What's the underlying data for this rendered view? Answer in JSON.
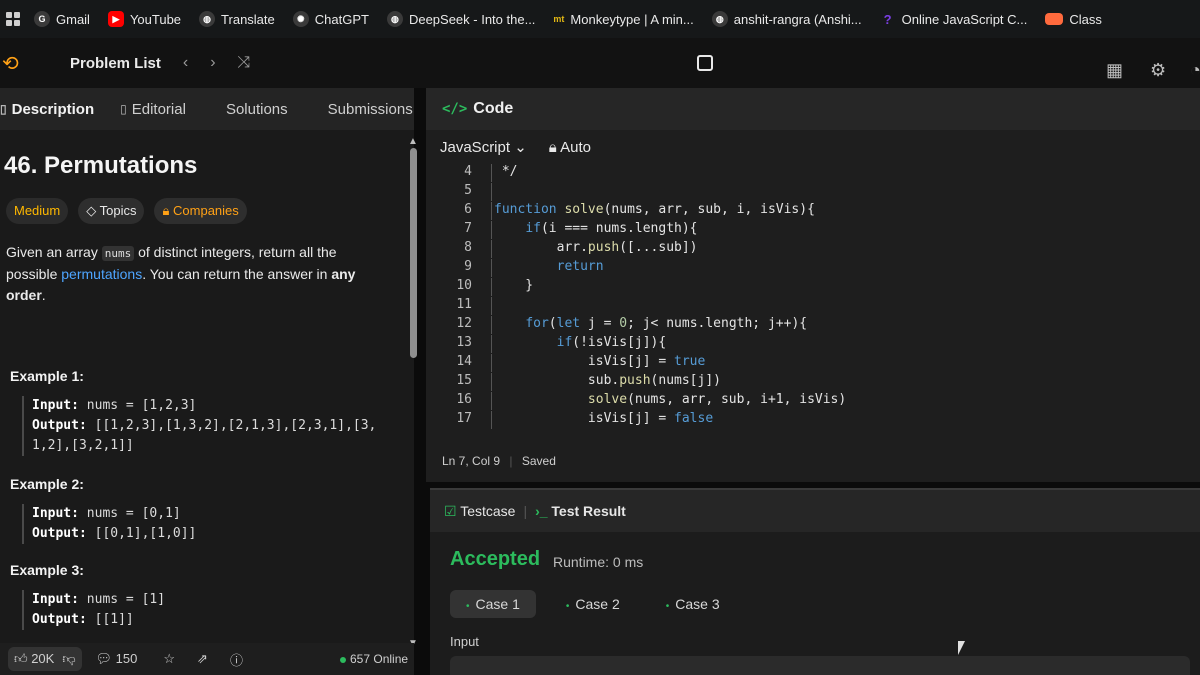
{
  "bookmarks": [
    {
      "label": "Gmail",
      "icon": "gmail-icon",
      "color": "#3a3a3a"
    },
    {
      "label": "YouTube",
      "icon": "youtube-icon",
      "color": "#ff0000"
    },
    {
      "label": "Translate",
      "icon": "translate-icon",
      "color": "#3a3a3a"
    },
    {
      "label": "ChatGPT",
      "icon": "chatgpt-icon",
      "color": "#3a3a3a"
    },
    {
      "label": "DeepSeek - Into the...",
      "icon": "deepseek-icon",
      "color": "#3a3a3a"
    },
    {
      "label": "Monkeytype | A min...",
      "icon": "monkeytype-icon",
      "color": "#e2b714"
    },
    {
      "label": "anshit-rangra (Anshi...",
      "icon": "github-icon",
      "color": "#3a3a3a"
    },
    {
      "label": "Online JavaScript C...",
      "icon": "js-compiler-icon",
      "color": "#7b3fe4"
    },
    {
      "label": "Class",
      "icon": "class-icon",
      "color": "#ff6a3d"
    }
  ],
  "nav": {
    "problem_list": "Problem List"
  },
  "tabs": {
    "description": "Description",
    "editorial": "Editorial",
    "solutions": "Solutions",
    "submissions": "Submissions"
  },
  "problem": {
    "title": "46. Permutations",
    "difficulty": "Medium",
    "topics": "Topics",
    "companies": "Companies",
    "desc_1": "Given an array",
    "desc_code": "nums",
    "desc_2": "of distinct integers, return all the possible",
    "desc_link": "permutations",
    "desc_3": ". You can return the answer in",
    "desc_bold": "any order",
    "desc_end": "."
  },
  "examples": [
    {
      "label": "Example 1:",
      "input_label": "Input:",
      "input": "nums = [1,2,3]",
      "output_label": "Output:",
      "output": "[[1,2,3],[1,3,2],[2,1,3],[2,3,1],[3,1,2],[3,2,1]]"
    },
    {
      "label": "Example 2:",
      "input_label": "Input:",
      "input": "nums = [0,1]",
      "output_label": "Output:",
      "output": "[[0,1],[1,0]]"
    },
    {
      "label": "Example 3:",
      "input_label": "Input:",
      "input": "nums = [1]",
      "output_label": "Output:",
      "output": "[[1]]"
    }
  ],
  "footer": {
    "likes": "20K",
    "comments": "150",
    "online": "657 Online"
  },
  "code": {
    "header": "Code",
    "language": "JavaScript",
    "mode": "Auto",
    "status_pos": "Ln 7, Col 9",
    "status_saved": "Saved",
    "lines": [
      {
        "n": "4",
        "text": " */"
      },
      {
        "n": "5",
        "text": ""
      },
      {
        "n": "6",
        "text": "function solve(nums, arr, sub, i, isVis){"
      },
      {
        "n": "7",
        "text": "    if(i === nums.length){"
      },
      {
        "n": "8",
        "text": "        arr.push([...sub])"
      },
      {
        "n": "9",
        "text": "        return"
      },
      {
        "n": "10",
        "text": "    }"
      },
      {
        "n": "11",
        "text": ""
      },
      {
        "n": "12",
        "text": "    for(let j = 0; j< nums.length; j++){"
      },
      {
        "n": "13",
        "text": "        if(!isVis[j]){"
      },
      {
        "n": "14",
        "text": "            isVis[j] = true"
      },
      {
        "n": "15",
        "text": "            sub.push(nums[j])"
      },
      {
        "n": "16",
        "text": "            solve(nums, arr, sub, i+1, isVis)"
      },
      {
        "n": "17",
        "text": "            isVis[j] = false"
      }
    ]
  },
  "result": {
    "testcase_tab": "Testcase",
    "result_tab": "Test Result",
    "verdict": "Accepted",
    "runtime": "Runtime: 0 ms",
    "cases": [
      "Case 1",
      "Case 2",
      "Case 3"
    ],
    "input_label": "Input"
  },
  "colors": {
    "accent": "#ffa116",
    "accepted": "#2cbb5d",
    "medium": "#ffb800",
    "link": "#4ea5ff"
  }
}
